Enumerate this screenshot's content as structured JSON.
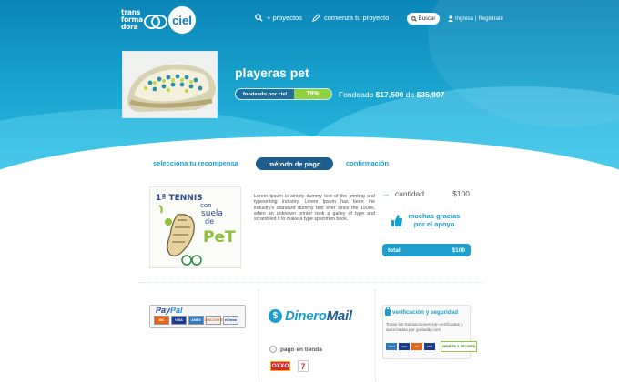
{
  "header": {
    "logo_text_lines": [
      "trans",
      "forma",
      "dora"
    ],
    "logo_ciel": "ciel",
    "nav": [
      {
        "label": "+ proyectos",
        "icon": "search-icon"
      },
      {
        "label": "comienza tu proyecto",
        "icon": "pencil-icon"
      }
    ],
    "search_label": "Buscar",
    "login_label": "Ingresa",
    "separator": "|",
    "register_label": "Registrate"
  },
  "project": {
    "title": "playeras pet",
    "funding_label": "fondeado por ciel",
    "percent_text": "79%",
    "percent": 79,
    "fondeado_prefix": "Fondeado",
    "raised": "$17,500",
    "de": "de",
    "goal": "$35,907"
  },
  "steps": {
    "step1": "selecciona tu recompensa",
    "step2": "método de pago",
    "step3": "confirmación"
  },
  "reward": {
    "image_text_lines": [
      "1ª TENNIS",
      "con",
      "suela",
      "de",
      "PeT"
    ],
    "description": "Lorem Ipsum is simply dummy text of the printing and typesetting industry. Lorem Ipsum has been the industry's standard dummy text ever since the 1500s, when an unknown printer took a galley of type and scrambled it to make a type specimen book."
  },
  "summary": {
    "cantidad_label": "cantidad",
    "cantidad_amount": "$100",
    "gracias": "muchas gracias por el apoyo",
    "total_label": "total",
    "total_amount": "$100"
  },
  "payment": {
    "paypal_pay": "Pay",
    "paypal_pal": "Pal",
    "paypal_cards": [
      "MC",
      "VISA",
      "AMEX",
      "DISCOVER",
      "eCheck"
    ],
    "dineromail_d": "Dinero",
    "dineromail_rest": "Mail",
    "dineromail_coin": "$",
    "tienda_label": "pago en tienda",
    "oxxo": "OXXO",
    "seven": "7"
  },
  "verification": {
    "title": "verificación y seguridad",
    "text": "Todas las transacciones son verificadas y autorizadas por godaddy.com",
    "cards": [
      "AMEX",
      "VISA",
      "MC",
      "VISA"
    ],
    "godaddy_badge": "VERIFIED & SECURED"
  },
  "colors": {
    "accent": "#1b9fcb",
    "dark_blue": "#1d5e8f",
    "progress_green": "#8fd13f"
  }
}
